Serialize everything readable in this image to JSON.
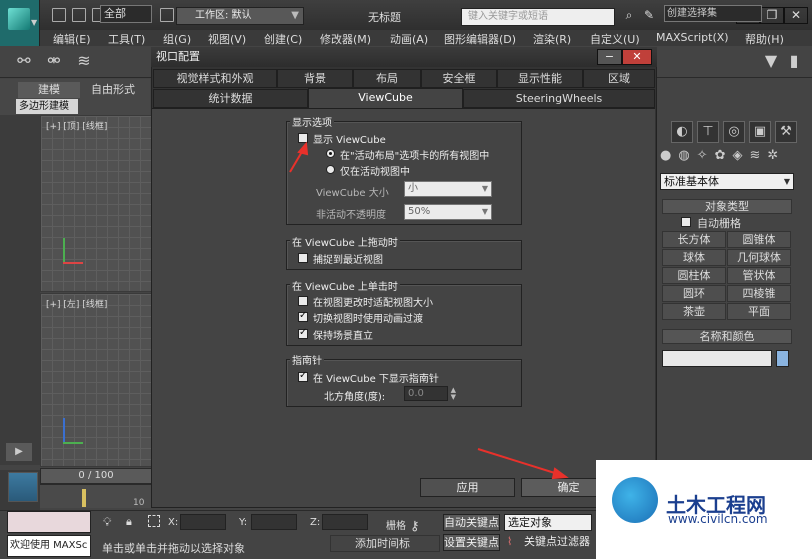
{
  "app": {
    "title": "无标题",
    "workspace": "工作区: 默认",
    "search_placeholder": "键入关键字或短语",
    "help_glyph": "?"
  },
  "menu": [
    "编辑(E)",
    "工具(T)",
    "组(G)",
    "视图(V)",
    "创建(C)",
    "修改器(M)",
    "动画(A)",
    "图形编辑器(D)",
    "渲染(R)",
    "自定义(U)",
    "MAXScript(X)",
    "帮助(H)"
  ],
  "toolbar": {
    "selection_filter": "全部",
    "named_selection": "创建选择集"
  },
  "ribbon": {
    "tabs": [
      "建模",
      "自由形式"
    ],
    "panel": "多边形建模"
  },
  "viewports": {
    "top_label": "[+] [顶] [线框]",
    "left_label": "[+] [左] [线框]"
  },
  "timeline": {
    "frame": "0 / 100",
    "tick": "10"
  },
  "statusbar": {
    "welcome": "欢迎使用  MAXSc",
    "hint": "单击或单击并拖动以选择对象",
    "x": "X:",
    "y": "Y:",
    "z": "Z:",
    "grid": "栅格",
    "add_time_tag": "添加时间标",
    "auto_key": "自动关键点",
    "set_key": "设置关键点",
    "selected_object": "选定对象",
    "key_filters": "关键点过滤器"
  },
  "command_panel": {
    "category": "标准基本体",
    "object_type": "对象类型",
    "auto_grid": "自动栅格",
    "buttons": [
      "长方体",
      "圆锥体",
      "球体",
      "几何球体",
      "圆柱体",
      "管状体",
      "圆环",
      "四棱锥",
      "茶壶",
      "平面"
    ],
    "name_color": "名称和颜色"
  },
  "dialog": {
    "title": "视口配置",
    "min_glyph": "−",
    "close_glyph": "✕",
    "tabs_row1": [
      "视觉样式和外观",
      "背景",
      "布局",
      "安全框",
      "显示性能",
      "区域"
    ],
    "tabs_row2": [
      "统计数据",
      "ViewCube",
      "SteeringWheels"
    ],
    "active_tab": "ViewCube",
    "display_group": {
      "title": "显示选项",
      "show_viewcube": "显示 ViewCube",
      "radio_all": "在\"活动布局\"选项卡的所有视图中",
      "radio_active": "仅在活动视图中",
      "size_label": "ViewCube 大小",
      "size_value": "小",
      "opacity_label": "非活动不透明度",
      "opacity_value": "50%"
    },
    "drag_group": {
      "title": "在 ViewCube 上拖动时",
      "snap": "捕捉到最近视图"
    },
    "click_group": {
      "title": "在 ViewCube 上单击时",
      "fit": "在视图更改时适配视图大小",
      "animate": "切换视图时使用动画过渡",
      "upright": "保持场景直立"
    },
    "compass_group": {
      "title": "指南针",
      "show_compass": "在 ViewCube 下显示指南针",
      "angle_label": "北方角度(度):",
      "angle_value": "0.0"
    },
    "apply": "应用",
    "ok": "确定"
  },
  "checks": {
    "show_viewcube": false,
    "radio_all": true,
    "snap": false,
    "fit": false,
    "animate": true,
    "upright": true,
    "show_compass": true,
    "auto_grid": false
  },
  "annotation_color": "#e8312b",
  "watermark": {
    "name": "土木工程网",
    "url": "www.civilcn.com"
  }
}
